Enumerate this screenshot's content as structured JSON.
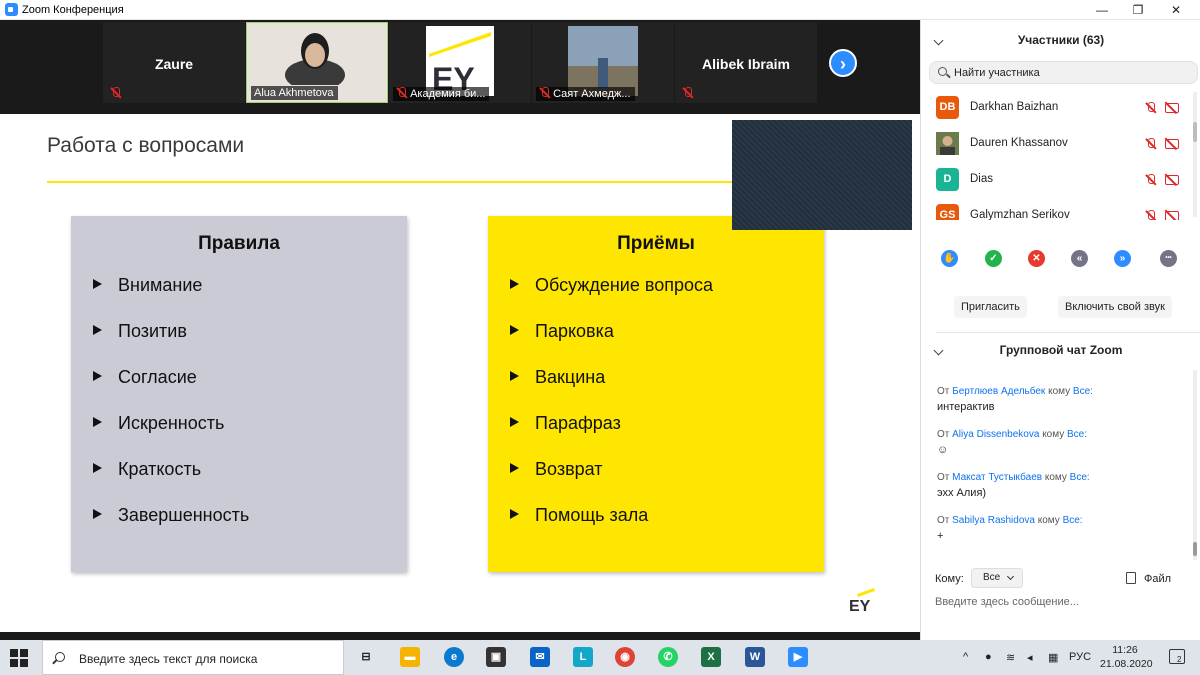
{
  "window": {
    "title": "Zoom Конференция",
    "minimize_icon": "—",
    "restore_icon": "❐",
    "close_icon": "✕"
  },
  "video_strip": {
    "tiles": [
      {
        "name": "Zaure",
        "label": ""
      },
      {
        "name": "",
        "label": "Alua Akhmetova"
      },
      {
        "name": "",
        "label": "Академия би..."
      },
      {
        "name": "",
        "label": "Саят Ахмедж..."
      },
      {
        "name": "Alibek Ibraim",
        "label": ""
      }
    ],
    "next_icon": "›"
  },
  "slide": {
    "title": "Работа с вопросами",
    "panel_left": {
      "title": "Правила",
      "items": [
        "Внимание",
        "Позитив",
        "Согласие",
        "Искренность",
        "Краткость",
        "Завершенность"
      ],
      "color": "#cbcbd6"
    },
    "panel_right": {
      "title": "Приёмы",
      "items": [
        "Обсуждение вопроса",
        "Парковка",
        "Вакцина",
        "Парафраз",
        "Возврат",
        "Помощь зала"
      ],
      "color": "#ffe600"
    },
    "logo": "EY"
  },
  "participants": {
    "header": "Участники (63)",
    "search_placeholder": "Найти участника",
    "list": [
      {
        "initials": "DB",
        "name": "Darkhan Baizhan",
        "color": "#e8590c"
      },
      {
        "initials": "",
        "name": "Dauren Khassanov",
        "color": "#6b7b4a"
      },
      {
        "initials": "D",
        "name": "Dias",
        "color": "#1ab394"
      },
      {
        "initials": "GS",
        "name": "Galymzhan Serikov",
        "color": "#e8590c"
      }
    ],
    "invite_label": "Пригласить",
    "unmute_label": "Включить свой звук"
  },
  "reactions": [
    {
      "icon": "hand-icon",
      "glyph": "✋",
      "color": "#2d8cff"
    },
    {
      "icon": "yes-icon",
      "glyph": "✓",
      "color": "#24b34b"
    },
    {
      "icon": "no-icon",
      "glyph": "✕",
      "color": "#e8392f"
    },
    {
      "icon": "slower-icon",
      "glyph": "«",
      "color": "#747487"
    },
    {
      "icon": "faster-icon",
      "glyph": "»",
      "color": "#2d8cff"
    },
    {
      "icon": "more-icon",
      "glyph": "•••",
      "color": "#747487"
    }
  ],
  "chat": {
    "header": "Групповой чат Zoom",
    "messages": [
      {
        "from_prefix": "От",
        "sender": "Бертлюев Адельбек",
        "to_word": "кому",
        "to": "Все:",
        "text": "интерактив"
      },
      {
        "from_prefix": "От",
        "sender": "Aliya Dissenbekova",
        "to_word": "кому",
        "to": "Все:",
        "text": "☺"
      },
      {
        "from_prefix": "От",
        "sender": "Максат Тустыкбаев",
        "to_word": "кому",
        "to": "Все:",
        "text": "эхх Алия)"
      },
      {
        "from_prefix": "От",
        "sender": "Sabilya Rashidova",
        "to_word": "кому",
        "to": "Все:",
        "text": "+"
      }
    ],
    "to_label": "Кому:",
    "to_value": "Все",
    "file_label": "Файл",
    "input_placeholder": "Введите здесь сообщение..."
  },
  "taskbar": {
    "search_placeholder": "Введите здесь текст для поиска",
    "apps": [
      {
        "icon": "task-view-icon",
        "glyph": "⊟",
        "color": "#dfe4ea"
      },
      {
        "icon": "file-explorer-icon",
        "glyph": "▬",
        "color": "#f4b400"
      },
      {
        "icon": "edge-icon",
        "glyph": "e",
        "color": "#0a7ad1"
      },
      {
        "icon": "store-icon",
        "glyph": "▣",
        "color": "#333333"
      },
      {
        "icon": "mail-icon",
        "glyph": "✉",
        "color": "#0a64c8"
      },
      {
        "icon": "l-app-icon",
        "glyph": "L",
        "color": "#13a8c9"
      },
      {
        "icon": "chrome-icon",
        "glyph": "◉",
        "color": "#db4437"
      },
      {
        "icon": "whatsapp-icon",
        "glyph": "✆",
        "color": "#25d366"
      },
      {
        "icon": "excel-icon",
        "glyph": "X",
        "color": "#1d7044"
      },
      {
        "icon": "word-icon",
        "glyph": "W",
        "color": "#2b579a"
      },
      {
        "icon": "zoom-icon",
        "glyph": "▶",
        "color": "#2d8cff"
      }
    ],
    "language": "РУС",
    "time": "11:26",
    "date": "21.08.2020",
    "notification_count": "2"
  }
}
